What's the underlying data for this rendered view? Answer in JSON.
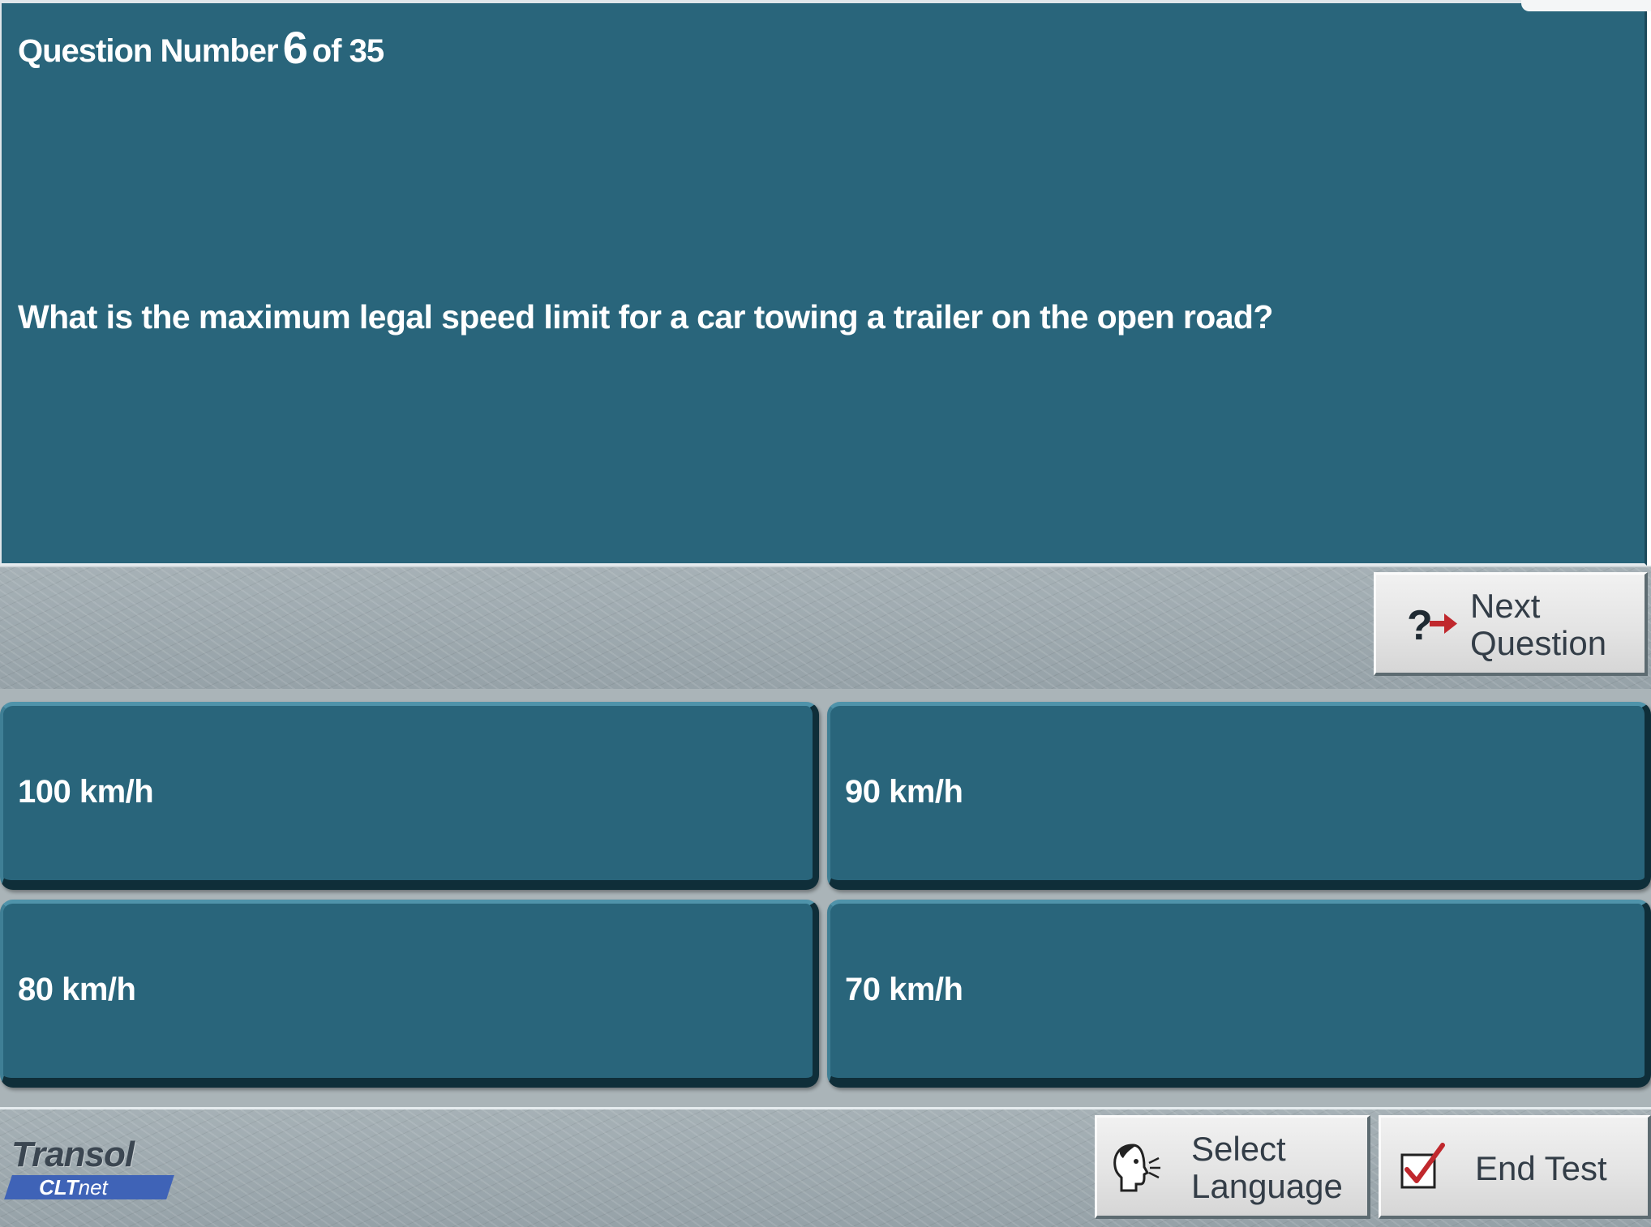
{
  "question": {
    "counter_prefix": "Question Number",
    "current_number": "6",
    "counter_suffix": "of 35",
    "text": "What is the maximum legal speed limit for a car towing a trailer on the open road?"
  },
  "answers": [
    {
      "label": "100 km/h"
    },
    {
      "label": "90 km/h"
    },
    {
      "label": "80 km/h"
    },
    {
      "label": "70 km/h"
    }
  ],
  "buttons": {
    "next_line1": "Next",
    "next_line2": "Question",
    "language_line1": "Select",
    "language_line2": "Language",
    "end_test": "End Test"
  },
  "icons": {
    "next": "question-arrow-icon",
    "language": "speaking-head-icon",
    "end_test": "checkmark-box-icon"
  },
  "logo": {
    "brand": "Transol",
    "product": "CLT",
    "product_suffix": "net"
  },
  "colors": {
    "panel": "#29657b",
    "arrow": "#c0282d",
    "check": "#c0282d"
  }
}
